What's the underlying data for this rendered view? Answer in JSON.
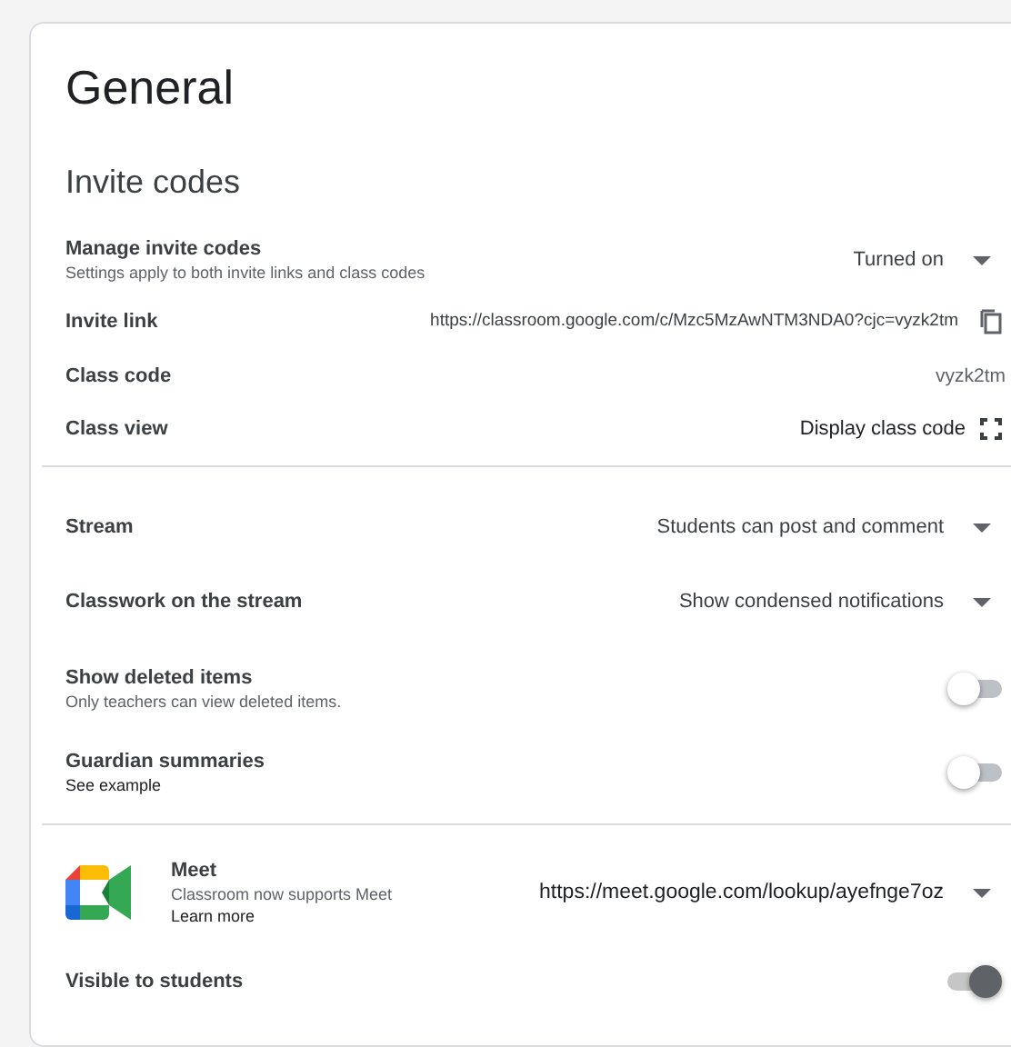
{
  "title": "General",
  "sections": [
    {
      "heading": "Invite codes",
      "rows": [
        {
          "kind": "dropdown",
          "label": "Manage invite codes",
          "description": "Settings apply to both invite links and class codes",
          "value": "Turned on"
        },
        {
          "kind": "link",
          "label": "Invite link",
          "value": "https://classroom.google.com/c/Mzc5MzAwNTM3NDA0?cjc=vyzk2tm"
        },
        {
          "kind": "text",
          "label": "Class code",
          "value": "vyzk2tm"
        },
        {
          "kind": "display",
          "label": "Class view",
          "value": "Display class code"
        }
      ]
    },
    {
      "rows": [
        {
          "kind": "dropdown",
          "label": "Stream",
          "value": "Students can post and comment"
        },
        {
          "kind": "dropdown",
          "label": "Classwork on the stream",
          "value": "Show condensed notifications"
        },
        {
          "kind": "toggle",
          "label": "Show deleted items",
          "description": "Only teachers can view deleted items.",
          "on": false
        },
        {
          "kind": "toggle",
          "label": "Guardian summaries",
          "link": "See example",
          "on": false
        }
      ]
    },
    {
      "rows": [
        {
          "kind": "meet",
          "label": "Meet",
          "description": "Classroom now supports Meet",
          "link": "Learn more",
          "value": "https://meet.google.com/lookup/ayefnge7oz"
        },
        {
          "kind": "toggle",
          "label": "Visible to students",
          "on": true
        }
      ]
    }
  ]
}
